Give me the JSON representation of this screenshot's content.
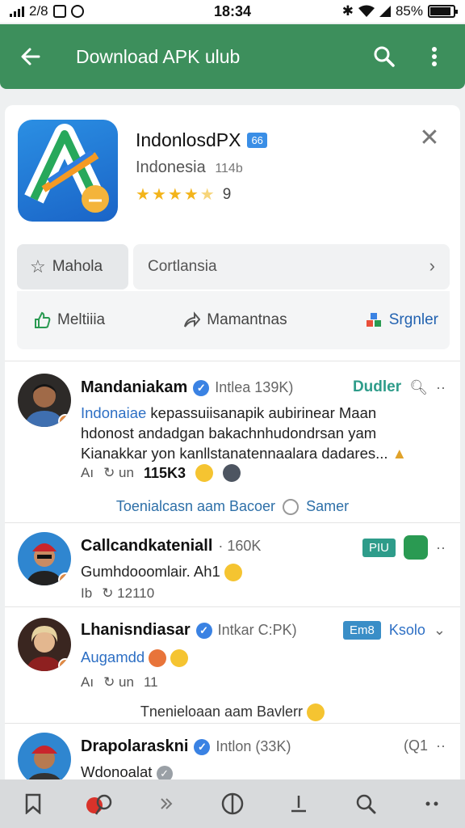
{
  "status": {
    "left_text": "2/8",
    "time": "18:34",
    "battery": "85%"
  },
  "appbar": {
    "title": "Download APK ulub",
    "icons": [
      "back-arrow-icon",
      "search-icon",
      "more-vert-icon"
    ]
  },
  "app": {
    "name": "IndonlosdPX",
    "badge": "66",
    "subtitle": "Indonesia",
    "size": "114b",
    "rating": "9",
    "stars": 4.5
  },
  "actions_row1": {
    "left_label": "Mahola",
    "right_label": "Cortlansia"
  },
  "actions_row2": {
    "a": "Meltiiia",
    "b": "Mamantnas",
    "c": "Srgnler"
  },
  "posts": [
    {
      "name": "Mandaniakam",
      "handle": "Intlea 139K)",
      "tag": "Dudler",
      "lines": [
        {
          "hl": "Indonaiae",
          "rest": " kepassuiisanapik aubirinear Maan"
        },
        {
          "hl": "",
          "rest": "hdonost andadgan bakachnhudondrsan yam"
        },
        {
          "hl": "",
          "rest": "Kianakkar yon kanllstanatennaalara dadares..."
        }
      ],
      "meta_a": "Aı",
      "meta_b": "↻ un",
      "meta_count": "115K3",
      "link": "Toenialcasn aam Bacoer",
      "link_b": "Samer"
    },
    {
      "name": "Callcandkateniall",
      "handle": "· 160K",
      "tag": "PIU",
      "lines": [
        {
          "hl": "",
          "rest": "Gumhdooomlair. Ah1"
        }
      ],
      "meta_a": "Ib",
      "meta_b": "↻ 12110"
    },
    {
      "name": "Lhanisndiasar",
      "handle": "Intkar C:PK)",
      "tag": "Em8",
      "tag_b": "Ksolo",
      "lines": [
        {
          "hl": "Augamdd",
          "rest": ""
        }
      ],
      "meta_a": "Aı",
      "meta_b": "↻ un",
      "meta_count": "11",
      "link": "Tnenieloaan aam Bavlerr"
    },
    {
      "name": "Drapolaraskni",
      "handle": "Intlon (33K)",
      "right": "(Q1",
      "lines": [
        {
          "hl": "",
          "rest": "Wdonoalat"
        }
      ]
    }
  ],
  "colors": {
    "appbar": "#3d8f5c",
    "accent_blue": "#2d6fc4",
    "tag_teal": "#2e9c8a",
    "star": "#f3b41b"
  },
  "bottomnav_icons": [
    "bookmark-icon",
    "apple-search-icon",
    "forward-icon",
    "circle-split-icon",
    "share-up-icon",
    "search-icon",
    "more-icon"
  ]
}
